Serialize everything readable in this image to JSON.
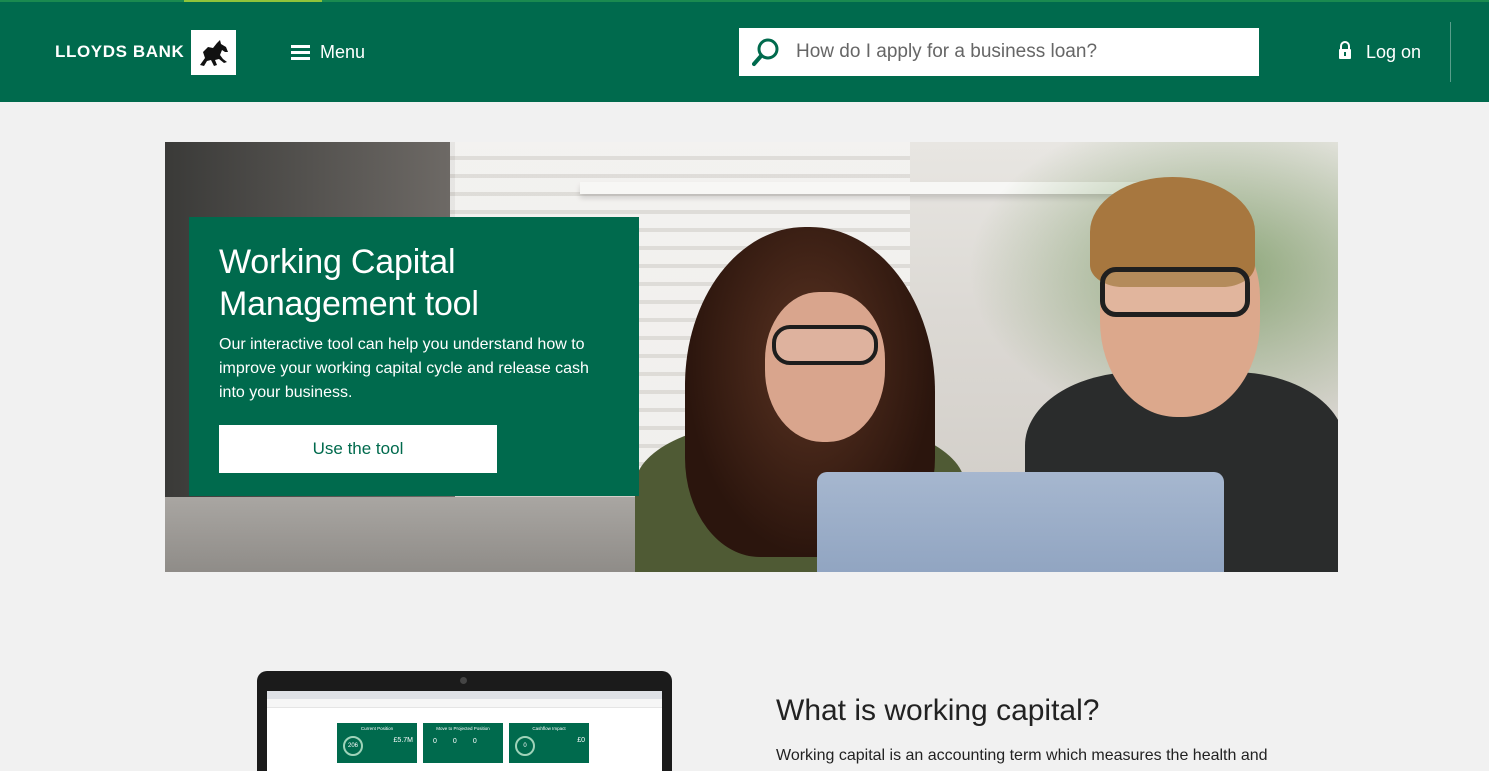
{
  "header": {
    "brand": "LLOYDS BANK",
    "menu_label": "Menu",
    "search_placeholder": "How do I apply for a business loan?",
    "login_label": "Log on",
    "bg_color": "#006a4d"
  },
  "hero": {
    "title_line1": "Working Capital",
    "title_line2": "Management tool",
    "description": "Our interactive tool can help you understand how to improve your working capital cycle and release cash into your business.",
    "cta_label": "Use the tool"
  },
  "mockup": {
    "tiles": [
      {
        "title": "Current Position",
        "ring": "206",
        "value": "£5.7M"
      },
      {
        "title": "Move to Projected Position",
        "zeros": [
          "0",
          "0",
          "0"
        ]
      },
      {
        "title": "Cashflow Impact",
        "ring": "0",
        "value": "£0"
      }
    ]
  },
  "section": {
    "title": "What is working capital?",
    "body": "Working capital is an accounting term which measures the health and"
  },
  "icons": {
    "logo": "black-horse-icon",
    "menu": "hamburger-icon",
    "search": "magnifier-icon",
    "login": "lock-icon"
  }
}
